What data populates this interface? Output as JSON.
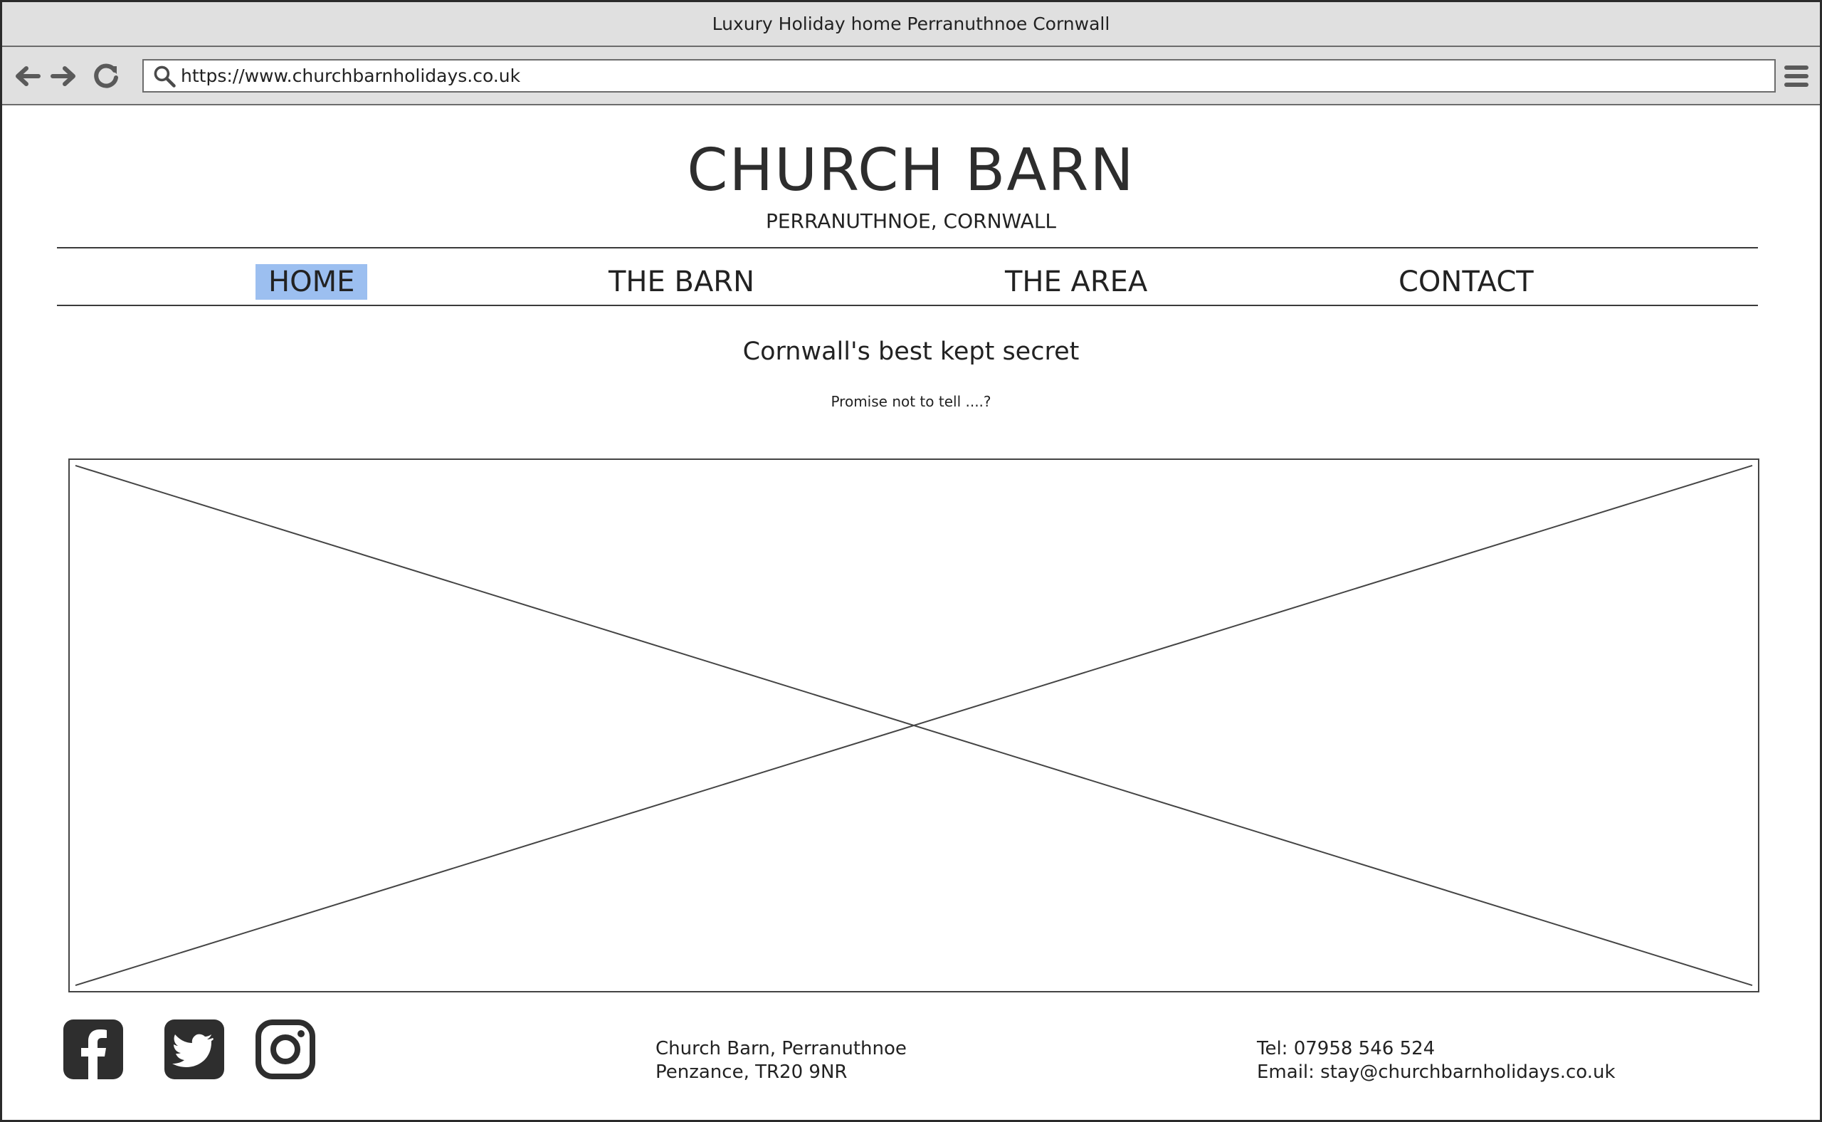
{
  "browser": {
    "window_title": "Luxury Holiday home Perranuthnoe Cornwall",
    "url": "https://www.churchbarnholidays.co.uk"
  },
  "site": {
    "title": "CHURCH BARN",
    "subtitle": "PERRANUTHNOE, CORNWALL"
  },
  "nav": {
    "items": [
      {
        "label": "HOME",
        "active": true
      },
      {
        "label": "THE BARN",
        "active": false
      },
      {
        "label": "THE AREA",
        "active": false
      },
      {
        "label": "CONTACT",
        "active": false
      }
    ]
  },
  "hero": {
    "headline": "Cornwall's best kept secret",
    "tagline": "Promise not to tell ....?"
  },
  "footer": {
    "social": [
      "facebook-icon",
      "twitter-icon",
      "instagram-icon"
    ],
    "address_line1": "Church Barn, Perranuthnoe",
    "address_line2": "Penzance, TR20 9NR",
    "tel": "Tel: 07958 546 524",
    "email": "Email: stay@churchbarnholidays.co.uk"
  },
  "colors": {
    "active_nav": "#9cbff0",
    "chrome": "#e0e0e0",
    "text": "#222222"
  }
}
